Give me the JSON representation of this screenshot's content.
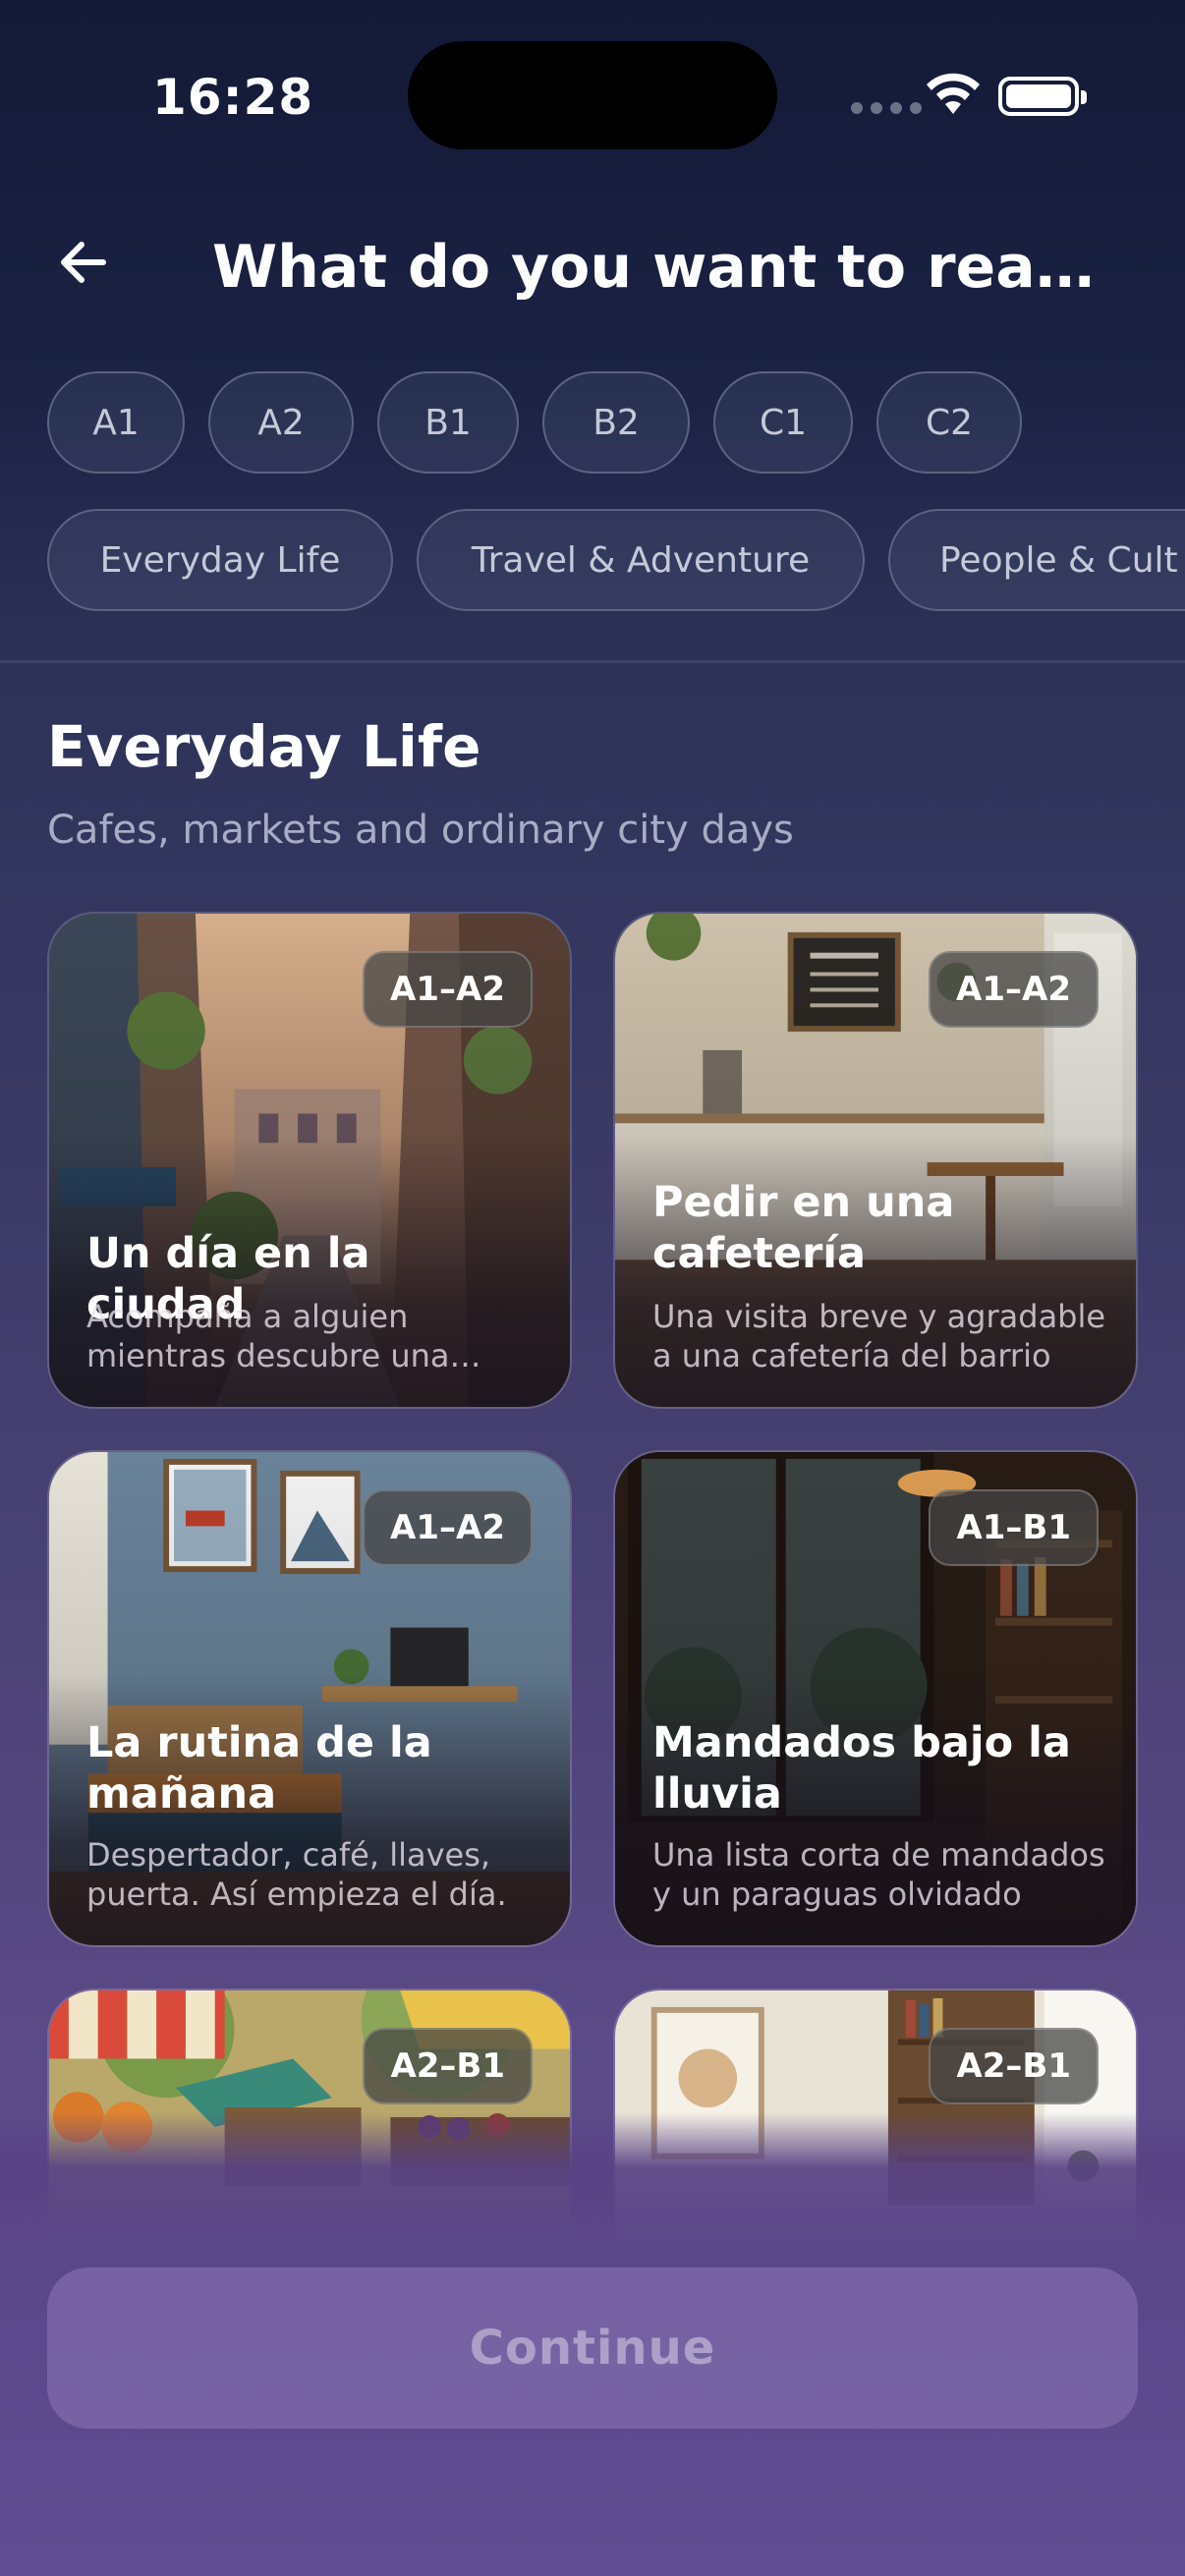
{
  "status_bar": {
    "time": "16:28"
  },
  "header": {
    "title": "What do you want to read a…",
    "back_icon": "arrow-left-icon"
  },
  "levels": [
    "A1",
    "A2",
    "B1",
    "B2",
    "C1",
    "C2"
  ],
  "topics": [
    "Everyday Life",
    "Travel & Adventure",
    "People & Cult"
  ],
  "section": {
    "title": "Everyday Life",
    "subtitle": "Cafes, markets and ordinary city days"
  },
  "cards": [
    {
      "title": "Un día en la ciudad",
      "description": "Acompaña a alguien mientras descubre una ciudad",
      "badge": "A1–A2"
    },
    {
      "title": "Pedir en una cafetería",
      "description": "Una visita breve y agradable a una cafetería del barrio",
      "badge": "A1–A2"
    },
    {
      "title": "La rutina de la mañana",
      "description": "Despertador, café, llaves, puerta. Así empieza el día.",
      "badge": "A1–A2"
    },
    {
      "title": "Mandados bajo la lluvia",
      "description": "Una lista corta de mandados y un paraguas olvidado",
      "badge": "A1–B1"
    },
    {
      "title": "",
      "description": "",
      "badge": "A2–B1"
    },
    {
      "title": "",
      "description": "",
      "badge": "A2–B1"
    }
  ],
  "footer": {
    "continue_label": "Continue"
  },
  "colors": {
    "background_top": "#131a37",
    "background_bottom": "#5f4b8e",
    "chip_border": "#5c6381"
  }
}
